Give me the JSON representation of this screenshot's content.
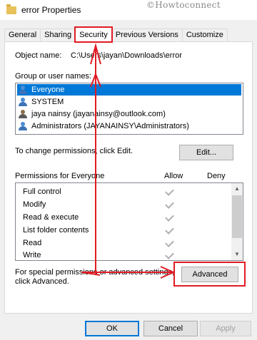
{
  "window": {
    "title": "error Properties",
    "watermark": "©Howtoconnect"
  },
  "tabs": [
    {
      "label": "General",
      "active": false
    },
    {
      "label": "Sharing",
      "active": false
    },
    {
      "label": "Security",
      "active": true
    },
    {
      "label": "Previous Versions",
      "active": false
    },
    {
      "label": "Customize",
      "active": false
    }
  ],
  "security": {
    "object_name_label": "Object name:",
    "object_name_value": "C:\\Users\\jayan\\Downloads\\error",
    "group_label": "Group or user names:",
    "users": [
      {
        "name": "Everyone",
        "selected": true,
        "icon": "users-group-icon"
      },
      {
        "name": "SYSTEM",
        "selected": false,
        "icon": "users-group-icon"
      },
      {
        "name": "jaya nainsy (jayanainsy@outlook.com)",
        "selected": false,
        "icon": "user-icon"
      },
      {
        "name": "Administrators (JAYANAINSY\\Administrators)",
        "selected": false,
        "icon": "users-group-icon"
      }
    ],
    "change_text": "To change permissions, click Edit.",
    "edit_button": "Edit...",
    "permissions_label": "Permissions for Everyone",
    "allow_header": "Allow",
    "deny_header": "Deny",
    "permissions": [
      {
        "name": "Full control",
        "allow": true,
        "deny": false
      },
      {
        "name": "Modify",
        "allow": true,
        "deny": false
      },
      {
        "name": "Read & execute",
        "allow": true,
        "deny": false
      },
      {
        "name": "List folder contents",
        "allow": true,
        "deny": false
      },
      {
        "name": "Read",
        "allow": true,
        "deny": false
      },
      {
        "name": "Write",
        "allow": true,
        "deny": false
      }
    ],
    "special_text_1": "For special permissions or advanced settings,",
    "special_text_2": "click Advanced.",
    "advanced_button": "Advanced"
  },
  "footer": {
    "ok": "OK",
    "cancel": "Cancel",
    "apply": "Apply"
  },
  "colors": {
    "highlight": "#e01b24",
    "selection": "#0078d7"
  }
}
